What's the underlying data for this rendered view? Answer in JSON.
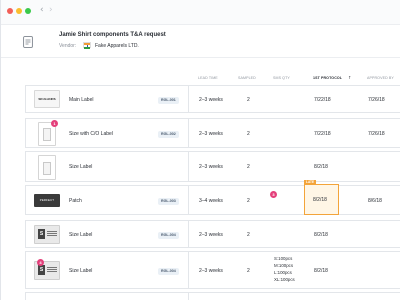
{
  "header": {
    "title": "Jamie Shirt components T&A request",
    "vendor_label": "Vendor:",
    "vendor_name": "Fake Apparels LTD."
  },
  "columns": {
    "lead_time": "LEAD TIME",
    "sampled": "SAMPLED",
    "sms_qty": "SMS QTY",
    "first_protocol": "1ST PROTOCOL",
    "approved_by": "APPROVED BY"
  },
  "icons": {
    "document": "document-icon",
    "sort": "sort-arrow-icon",
    "back": "chevron-left-icon",
    "forward": "chevron-right-icon"
  },
  "thumb_texts": {
    "main_label": "SKULLKIDS",
    "patch": "PERFECT"
  },
  "rows": [
    {
      "name": "Main Label",
      "code": "RGL-001",
      "lead_time": "2–3 weeks",
      "sampled": "2",
      "sms_qty": "",
      "first_protocol": "7/22/18",
      "approved_by": "7/26/18"
    },
    {
      "name": "Size with C/O Label",
      "code": "RGL-002",
      "lead_time": "2–3 weeks",
      "sampled": "2",
      "sms_qty": "",
      "first_protocol": "7/22/18",
      "approved_by": "7/26/18",
      "badge": "1"
    },
    {
      "name": "Size  Label",
      "code": "",
      "lead_time": "2–3 weeks",
      "sampled": "2",
      "sms_qty": "",
      "first_protocol": "8/2/18",
      "approved_by": ""
    },
    {
      "name": "Patch",
      "code": "RGL-003",
      "lead_time": "3–4 weeks",
      "sampled": "2",
      "sms_qty": "",
      "first_protocol": "8/2/18",
      "approved_by": "8/6/18",
      "badge": "3",
      "tag": "LATE"
    },
    {
      "name": "Size Label",
      "code": "RGL-004",
      "lead_time": "2–3 weeks",
      "sampled": "2",
      "sms_qty": "",
      "first_protocol": "8/2/18",
      "approved_by": ""
    },
    {
      "name": "Size Label",
      "code": "RGL-004",
      "lead_time": "2–3 weeks",
      "sampled": "2",
      "sms_qty": [
        "S:100pcs",
        "M:100pcs",
        "L:100pcs",
        "XL:100pcs"
      ],
      "first_protocol": "8/2/18",
      "approved_by": "",
      "badge": "4"
    }
  ],
  "colors": {
    "accent": "#f3a43a",
    "badge": "#e4407b",
    "chip_bg": "#eaf0f6"
  }
}
